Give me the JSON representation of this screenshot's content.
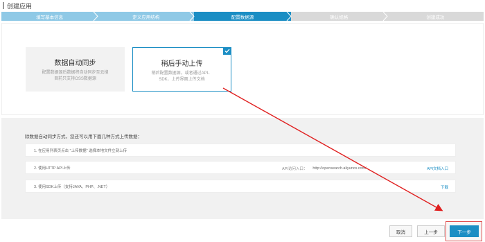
{
  "app": {
    "title": "创建应用"
  },
  "steps": [
    {
      "label": "填写基本信息",
      "state": "done"
    },
    {
      "label": "定义应用结构",
      "state": "done"
    },
    {
      "label": "配置数据源",
      "state": "active"
    },
    {
      "label": "确认规格",
      "state": "todo"
    },
    {
      "label": "创建成功",
      "state": "todo"
    }
  ],
  "cards": {
    "auto": {
      "title": "数据自动同步",
      "desc_line1": "配置数据源后数据将自动同步至云搜",
      "desc_line2": "目前只支持OSS数据源"
    },
    "manual": {
      "title": "稍后手动上传",
      "desc_line1": "稍后配置数据源，或者通过API、",
      "desc_line2": "SDK、上传界面上传文档",
      "selected": true
    }
  },
  "upload": {
    "intro": "除数据自动同步方式，您还可以用下面几种方式上传数据：",
    "rows": [
      {
        "text": "1. 在应用列表页点击 \"上传数据\" 选择本地文件立刻上传"
      },
      {
        "text": "2. 使用HTTP API上传",
        "entry_label": "API访问入口：",
        "entry_url": "http://opensearch.aliyuncs.com/",
        "link": "API文档入口"
      },
      {
        "text": "3. 使用SDK上传（支持JAVA、PHP、.NET）",
        "link": "下载"
      }
    ]
  },
  "footer": {
    "cancel": "取消",
    "prev": "上一步",
    "next": "下一步"
  },
  "colors": {
    "accent": "#1b8ec4",
    "done": "#8fc9e6",
    "todo": "#d9d9d9",
    "annotation": "#e02020"
  }
}
